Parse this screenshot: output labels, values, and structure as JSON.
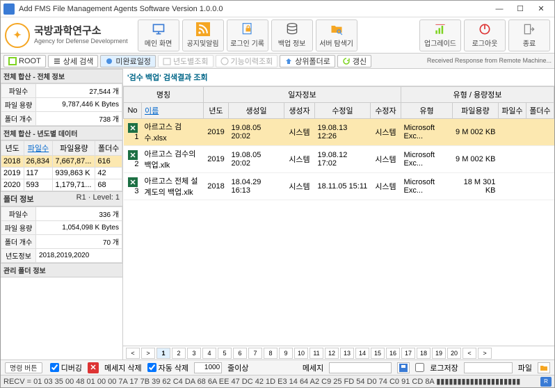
{
  "window": {
    "title": "Add FMS File Management Agents Software Version 1.0.0.0"
  },
  "logo": {
    "korean": "국방과학연구소",
    "english": "Agency for Defense Development"
  },
  "toolbar": {
    "main_screen": "메인 화면",
    "notice": "공지및알림",
    "login_log": "로그인 기록",
    "backup_info": "백업 정보",
    "server_explore": "서버 탐색기",
    "upgrade": "업그레이드",
    "logout": "로그아웃",
    "exit": "종료"
  },
  "subbar": {
    "root": "ROOT",
    "detail_search": "상세 검색",
    "incomplete": "미완료일정",
    "yearly": "년도별조회",
    "history": "기능이력조회",
    "to_upper": "상위폴더로",
    "refresh": "갱신",
    "recv_msg": "Received Response from Remote Machine..."
  },
  "left": {
    "h1": "전체 합산 - 전체 정보",
    "total": {
      "file_count_l": "파일수",
      "file_count_v": "27,544 개",
      "file_size_l": "파일 용량",
      "file_size_v": "9,787,446 K Bytes",
      "folder_count_l": "폴더 개수",
      "folder_count_v": "738 개"
    },
    "h2": "전체 합산 - 년도별 데이터",
    "yhead": {
      "year": "년도",
      "fc": "파일수",
      "fs": "파일용량",
      "dc": "폴더수"
    },
    "yrows": [
      {
        "y": "2018",
        "fc": "26,834",
        "fs": "7,667,87...",
        "dc": "616"
      },
      {
        "y": "2019",
        "fc": "117",
        "fs": "939,863 K",
        "dc": "42"
      },
      {
        "y": "2020",
        "fc": "593",
        "fs": "1,179,71...",
        "dc": "68"
      }
    ],
    "h3": "폴더 정보",
    "h3_r": "R1 · Level: 1",
    "folder": {
      "file_count_l": "파일수",
      "file_count_v": "336 개",
      "file_size_l": "파일 용량",
      "file_size_v": "1,054,098 K Bytes",
      "folder_count_l": "폴더 개수",
      "folder_count_v": "70 개",
      "year_info_l": "년도정보",
      "year_info_v": "2018,2019,2020"
    },
    "h4": "관리 폴더 정보"
  },
  "right": {
    "title": "'검수 백업' 검색결과 조회",
    "head_group1": "명칭",
    "head_group2": "일자정보",
    "head_group3": "유형 / 용량정보",
    "cols": {
      "no": "No",
      "name": "이름",
      "year": "년도",
      "created": "생성일",
      "creator": "생성자",
      "modified": "수정일",
      "modifier": "수정자",
      "type": "유형",
      "size": "파일용량",
      "filecnt": "파일수",
      "foldercnt": "폴더수"
    },
    "rows": [
      {
        "no": "1",
        "name": "아르고스 검수.xlsx",
        "year": "2019",
        "created": "19.08.05 20:02",
        "creator": "시스템",
        "modified": "19.08.13 12:26",
        "modifier": "시스템",
        "type": "Microsoft Exc...",
        "size": "9 M 002 KB",
        "sel": true
      },
      {
        "no": "2",
        "name": "아르고스 검수의 백업.xlk",
        "year": "2019",
        "created": "19.08.05 20:02",
        "creator": "시스템",
        "modified": "19.08.12 17:02",
        "modifier": "시스템",
        "type": "Microsoft Exc...",
        "size": "9 M 002 KB",
        "sel": false
      },
      {
        "no": "3",
        "name": "아르고스 전체 설계도의 백업.xlk",
        "year": "2018",
        "created": "18.04.29 16:13",
        "creator": "시스템",
        "modified": "18.11.05 15:11",
        "modifier": "시스템",
        "type": "Microsoft Exc...",
        "size": "18 M 301 KB",
        "sel": false
      }
    ],
    "pager": {
      "pages": [
        "<",
        ">",
        "1",
        "2",
        "3",
        "4",
        "5",
        "6",
        "7",
        "8",
        "9",
        "10",
        "11",
        "12",
        "13",
        "14",
        "15",
        "16",
        "17",
        "18",
        "19",
        "20",
        "<",
        ">"
      ],
      "cur": "1"
    }
  },
  "bottom": {
    "cmd_btn": "명령 버튼",
    "debug": "디버깅",
    "del_msg": "메세지 삭제",
    "auto_del": "자동 삭제",
    "lines": "1000",
    "lines_suffix": "줄이상",
    "msg_l": "메세지",
    "log_save": "로그저장",
    "file_l": "파일"
  },
  "status": {
    "recv": "RECV = 01 03 35 00 48 01 00 00 7A 17 7B 39 62 C4 DA 68 6A EE 47 DC 42 1D E3 14 64 A2 C9 25 FD 54 D0 74 C0 91 CD 8A ▮▮▮▮▮▮▮▮▮▮▮▮▮▮▮▮▮▮▮▮",
    "r": "R"
  }
}
